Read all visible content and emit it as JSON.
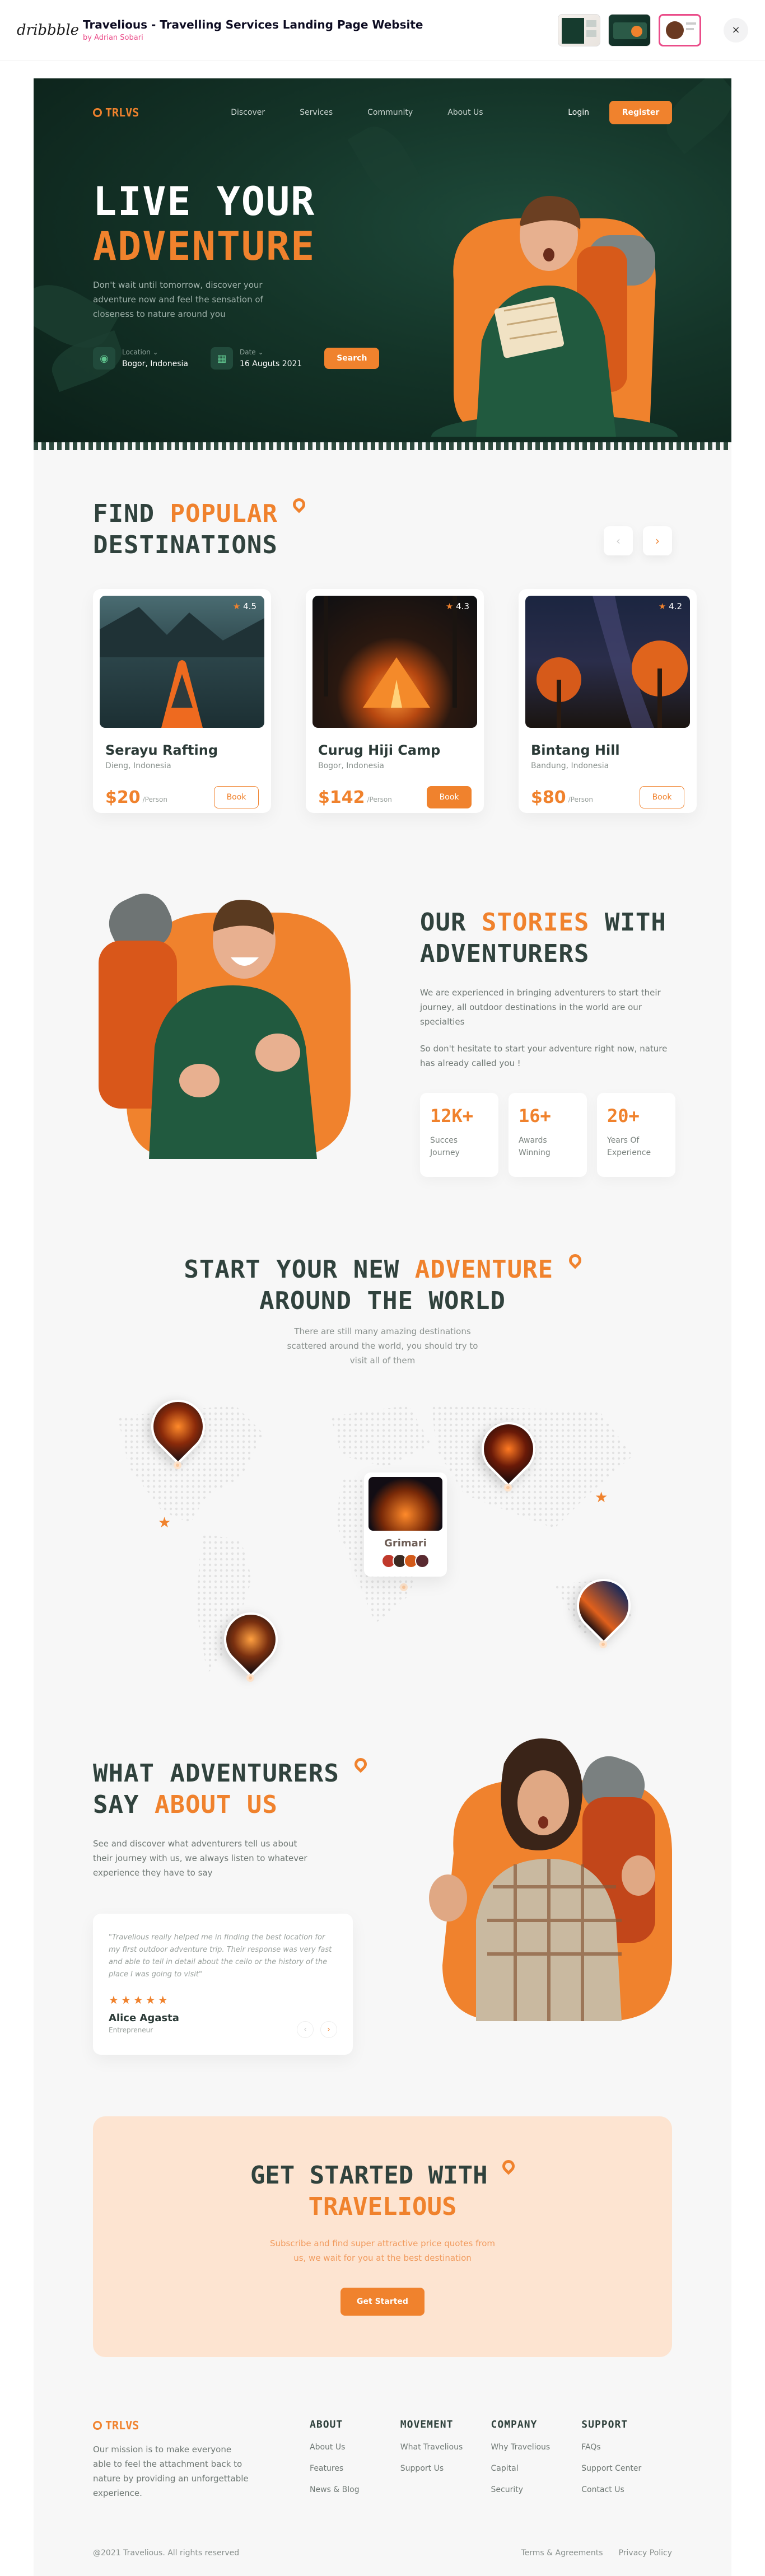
{
  "shot": {
    "logo": "dribbble",
    "title": "Travelious - Travelling Services Landing Page Website",
    "author_prefix": "by",
    "author": "Adrian Sobari",
    "close": "×"
  },
  "nav": {
    "logo": "TRLVS",
    "links": [
      "Discover",
      "Services",
      "Community",
      "About Us"
    ],
    "login": "Login",
    "register": "Register"
  },
  "hero": {
    "title_line1": "LIVE YOUR",
    "title_line2": "ADVENTURE",
    "subtitle": "Don't wait until tomorrow, discover your adventure now and feel the sensation of closeness to nature around you",
    "location_label": "Location",
    "location_value": "Bogor, Indonesia",
    "date_label": "Date",
    "date_value": "16 Auguts 2021",
    "search": "Search"
  },
  "popular": {
    "title_a": "FIND",
    "title_b": "POPULAR",
    "title_c": "DESTINATIONS",
    "prev": "‹",
    "next": "›",
    "cards": [
      {
        "name": "Serayu Rafting",
        "location": "Dieng, Indonesia",
        "price": "$20",
        "per": "/Person",
        "rating": "4.5",
        "book": "Book"
      },
      {
        "name": "Curug Hiji Camp",
        "location": "Bogor, Indonesia",
        "price": "$142",
        "per": "/Person",
        "rating": "4.3",
        "book": "Book"
      },
      {
        "name": "Bintang Hill",
        "location": "Bandung, Indonesia",
        "price": "$80",
        "per": "/Person",
        "rating": "4.2",
        "book": "Book"
      }
    ]
  },
  "stories": {
    "title_a": "OUR",
    "title_b": "STORIES",
    "title_c": "WITH",
    "title_d": "ADVENTURERS",
    "p1": "We are experienced in bringing adventurers to start their journey, all outdoor destinations in the world are our specialties",
    "p2": "So don't hesitate to start your adventure right now, nature has already called you !",
    "stats": [
      {
        "num": "12K+",
        "label": "Succes Journey"
      },
      {
        "num": "16+",
        "label": "Awards Winning"
      },
      {
        "num": "20+",
        "label": "Years Of Experience"
      }
    ]
  },
  "worldmap": {
    "title_a": "START YOUR NEW",
    "title_b": "ADVENTURE",
    "title_c": "AROUND THE WORLD",
    "subtitle": "There are still many amazing destinations scattered around the world, you should try to visit all of them",
    "featured": "Grimari"
  },
  "testimonial": {
    "title_a": "WHAT ADVENTURERS",
    "title_b": "SAY",
    "title_c": "ABOUT US",
    "subtitle": "See and discover what adventurers tell us about their journey with us, we always listen to whatever experience they have to say",
    "quote": "\"Travelious really helped me in finding the best location for my first outdoor adventure trip. Their response was very fast and able to tell in detail about the ceilo or the history of the place I was going to visit\"",
    "stars": "★★★★★",
    "name": "Alice Agasta",
    "role": "Entrepreneur",
    "prev": "‹",
    "next": "›"
  },
  "cta": {
    "title_a": "GET STARTED WITH",
    "title_b": "TRAVELIOUS",
    "subtitle": "Subscribe and find super attractive price quotes from us, we wait for you at the best destination",
    "button": "Get Started"
  },
  "footer": {
    "logo": "TRLVS",
    "mission": "Our mission is to make everyone able to feel the attachment back to nature by providing an unforgettable experience.",
    "columns": [
      {
        "title": "ABOUT",
        "links": [
          "About Us",
          "Features",
          "News & Blog"
        ]
      },
      {
        "title": "MOVEMENT",
        "links": [
          "What Travelious",
          "Support Us"
        ]
      },
      {
        "title": "COMPANY",
        "links": [
          "Why Travelious",
          "Capital",
          "Security"
        ]
      },
      {
        "title": "SUPPORT",
        "links": [
          "FAQs",
          "Support Center",
          "Contact Us"
        ]
      }
    ],
    "copyright": "@2021 Travelious. All rights reserved",
    "terms": "Terms & Agreements",
    "privacy": "Privacy Policy"
  },
  "colors": {
    "accent": "#f0822d",
    "dark_green": "#143428",
    "heading": "#30423d"
  }
}
